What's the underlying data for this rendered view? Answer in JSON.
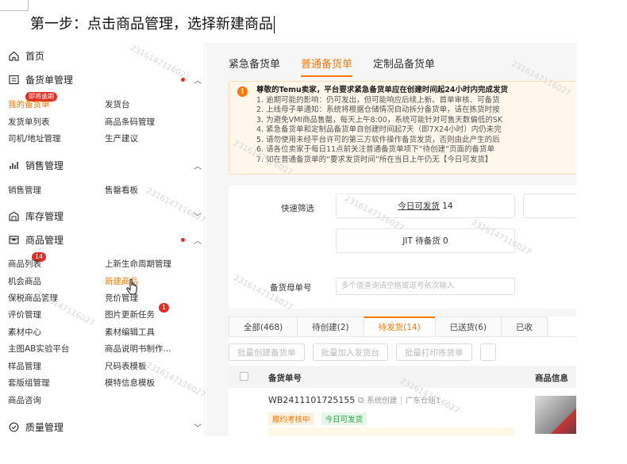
{
  "doc": {
    "instruction": "第一步：点击商品管理，选择新建商品"
  },
  "sidebar": {
    "home": "首页",
    "stock_order": {
      "label": "备货单管理",
      "items": [
        {
          "label": "我的备货单",
          "badge": "即将逾期"
        },
        {
          "label": "发货台"
        },
        {
          "label": "发货单列表"
        },
        {
          "label": "商品条码管理"
        },
        {
          "label": "司机/地址管理"
        },
        {
          "label": "生产建议"
        }
      ]
    },
    "sales": {
      "label": "销售管理",
      "items": [
        {
          "label": "销售管理"
        },
        {
          "label": "售罄看板"
        }
      ]
    },
    "inventory": {
      "label": "库存管理"
    },
    "product": {
      "label": "商品管理",
      "items": [
        {
          "label": "商品列表",
          "badge": "14"
        },
        {
          "label": "上新生命周期管理"
        },
        {
          "label": "机会商品"
        },
        {
          "label": "新建商品"
        },
        {
          "label": "保税商品管理"
        },
        {
          "label": "竞价管理"
        },
        {
          "label": "评价管理"
        },
        {
          "label": "图片更新任务",
          "badge": "1"
        },
        {
          "label": "素材中心"
        },
        {
          "label": "素材编辑工具"
        },
        {
          "label": "主图AB实验平台"
        },
        {
          "label": "商品说明书制作..."
        },
        {
          "label": "样品管理"
        },
        {
          "label": "尺码表模板"
        },
        {
          "label": "套版组管理"
        },
        {
          "label": "模特信息模板"
        },
        {
          "label": "商品咨询"
        }
      ]
    },
    "quality": {
      "label": "质量管理"
    }
  },
  "main": {
    "tabs": [
      "紧急备货单",
      "普通备货单",
      "定制品备货单"
    ],
    "notice": {
      "head": "尊敬的Temu卖家，平台要求紧急备货单应在创建时间起24小时内完成发货",
      "lines": [
        "1. 逾期可能的影响：仍可发出，但可能响应后续上新、首单审核、可备货",
        "2. 上线母子单通知：系统将根据仓储情况自动拆分备货单，请在拣货时按",
        "3. 为避免VMI商品售罄，每天上午8:00，系统可能针对可售天数偏低的SK",
        "4. 紧急备货单和定制品备货单自创建时间起7天（即7X24小时）内仍未完",
        "5. 请勿使用未经平台许可的第三方软件操作备货发货，否则由此产生的后",
        "6. 请各位卖家于每日11点前关注普通备货单项下“待创建”页面的备货单",
        "7. 如在普通备货单的“要求发货时间”所在当日上午仍无【今日可发货】"
      ]
    },
    "filter": {
      "quick_label": "快速筛选",
      "today_prefix": "今日可发货",
      "today_count": "14",
      "jit_prefix": "JIT 待备货",
      "jit_count": "0",
      "order_label": "备货母单号",
      "order_placeholder": "多个值查询请空格或逗号依次输入"
    },
    "status_tabs": [
      "全部(468)",
      "待创建(2)",
      "待发货(14)",
      "已送货(6)",
      "已收"
    ],
    "actions": [
      "批量创建备货单",
      "批量加入发货台",
      "批量打印拣货单"
    ],
    "table": {
      "col_order": "备货单号",
      "col_product": "商品信息",
      "row": {
        "order_no": "WB2411101725155",
        "source": "系统创建",
        "group": "广东仓组1",
        "tag1": "履约考核中",
        "tag2": "今日可发货"
      }
    }
  },
  "watermark": "2316147116027",
  "colors": {
    "accent": "#fb7701",
    "red": "#e02e24",
    "green": "#2aa245"
  }
}
